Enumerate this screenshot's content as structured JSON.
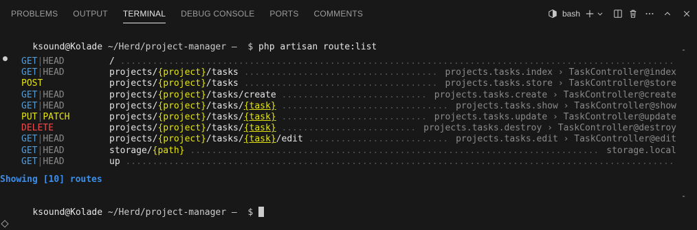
{
  "tabs": [
    "PROBLEMS",
    "OUTPUT",
    "TERMINAL",
    "DEBUG CONSOLE",
    "PORTS",
    "COMMENTS"
  ],
  "active_tab": "TERMINAL",
  "shell": "bash",
  "prompt": {
    "user": "ksound@Kolade",
    "path": "~/Herd/project-manager",
    "separator": "–",
    "symbol": "$"
  },
  "command": "php artisan route:list",
  "routes": [
    {
      "methods": [
        "GET",
        "HEAD"
      ],
      "path": "/",
      "name": ""
    },
    {
      "methods": [
        "GET",
        "HEAD"
      ],
      "path": "projects/{project}/tasks",
      "name": "projects.tasks.index › TaskController@index"
    },
    {
      "methods": [
        "POST"
      ],
      "path": "projects/{project}/tasks",
      "name": "projects.tasks.store › TaskController@store"
    },
    {
      "methods": [
        "GET",
        "HEAD"
      ],
      "path": "projects/{project}/tasks/create",
      "name": "projects.tasks.create › TaskController@create"
    },
    {
      "methods": [
        "GET",
        "HEAD"
      ],
      "path": "projects/{project}/tasks/{task}",
      "name": "projects.tasks.show › TaskController@show"
    },
    {
      "methods": [
        "PUT",
        "PATCH"
      ],
      "path": "projects/{project}/tasks/{task}",
      "name": "projects.tasks.update › TaskController@update"
    },
    {
      "methods": [
        "DELETE"
      ],
      "path": "projects/{project}/tasks/{task}",
      "name": "projects.tasks.destroy › TaskController@destroy"
    },
    {
      "methods": [
        "GET",
        "HEAD"
      ],
      "path": "projects/{project}/tasks/{task}/edit",
      "name": "projects.tasks.edit › TaskController@edit"
    },
    {
      "methods": [
        "GET",
        "HEAD"
      ],
      "path": "storage/{path}",
      "name": "storage.local"
    },
    {
      "methods": [
        "GET",
        "HEAD"
      ],
      "path": "up",
      "name": ""
    }
  ],
  "summary": "Showing [10] routes",
  "icons": {
    "shell": "terminal-shell-icon",
    "new_terminal": "plus-icon",
    "dropdown": "chevron-down-icon",
    "split": "split-terminal-icon",
    "kill": "trash-icon",
    "more": "ellipsis-icon",
    "maximize": "chevron-up-icon",
    "close": "close-icon"
  },
  "colors": {
    "background": "#181818",
    "method_get": "#569cd6",
    "method_post": "#e5e510",
    "method_delete": "#f14c4c",
    "param": "#e5e510",
    "summary": "#3b8eea"
  }
}
